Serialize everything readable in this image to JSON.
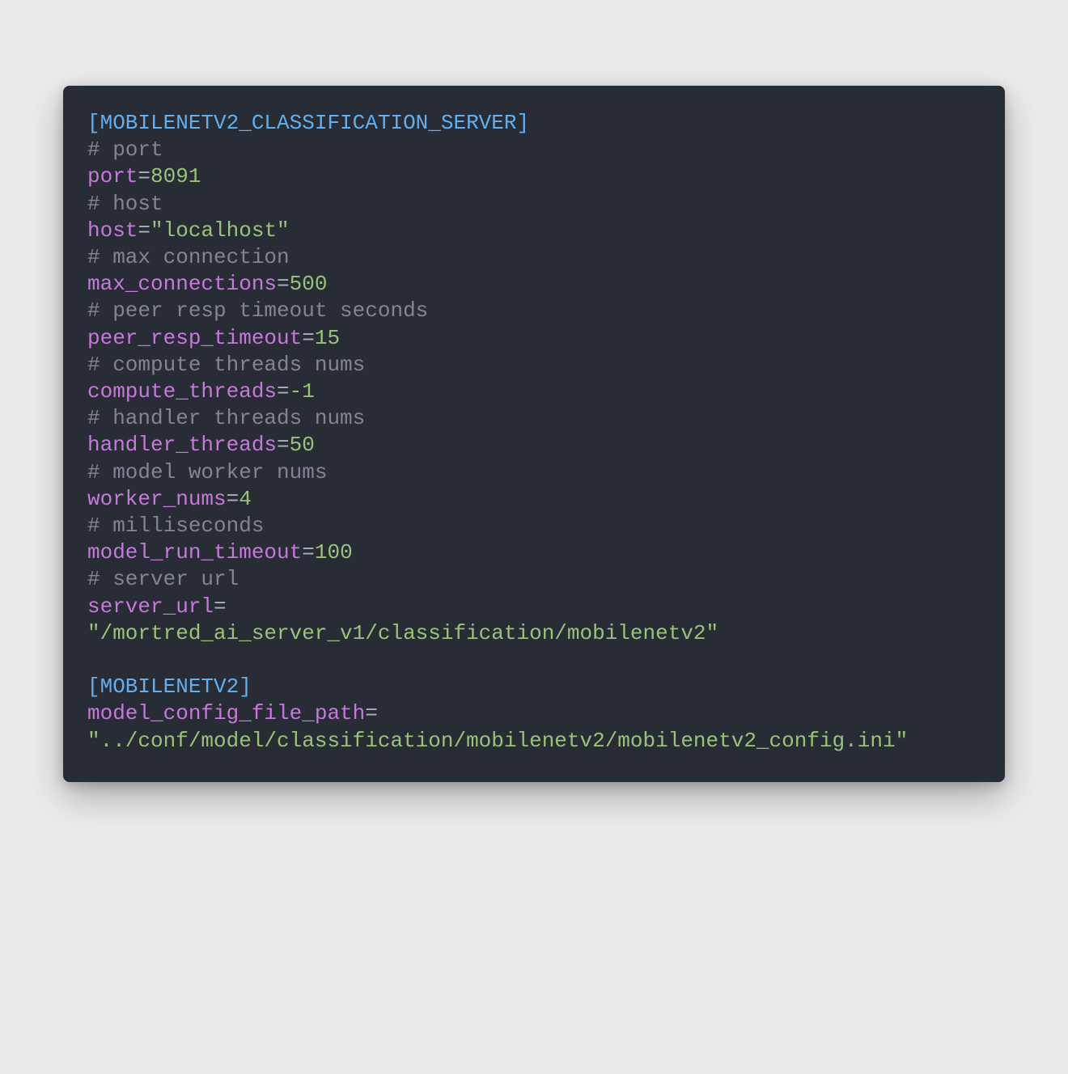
{
  "sections": [
    {
      "header": "MOBILENETV2_CLASSIFICATION_SERVER",
      "entries": [
        {
          "kind": "comment",
          "text": "# port"
        },
        {
          "kind": "kv",
          "key": "port",
          "value": "8091",
          "value_type": "number"
        },
        {
          "kind": "comment",
          "text": "# host"
        },
        {
          "kind": "kv",
          "key": "host",
          "value": "\"localhost\"",
          "value_type": "string"
        },
        {
          "kind": "comment",
          "text": "# max connection"
        },
        {
          "kind": "kv",
          "key": "max_connections",
          "value": "500",
          "value_type": "number"
        },
        {
          "kind": "comment",
          "text": "# peer resp timeout seconds"
        },
        {
          "kind": "kv",
          "key": "peer_resp_timeout",
          "value": "15",
          "value_type": "number"
        },
        {
          "kind": "comment",
          "text": "# compute threads nums"
        },
        {
          "kind": "kv",
          "key": "compute_threads",
          "value": "-1",
          "value_type": "number"
        },
        {
          "kind": "comment",
          "text": "# handler threads nums"
        },
        {
          "kind": "kv",
          "key": "handler_threads",
          "value": "50",
          "value_type": "number"
        },
        {
          "kind": "comment",
          "text": "# model worker nums"
        },
        {
          "kind": "kv",
          "key": "worker_nums",
          "value": "4",
          "value_type": "number"
        },
        {
          "kind": "comment",
          "text": "# milliseconds"
        },
        {
          "kind": "kv",
          "key": "model_run_timeout",
          "value": "100",
          "value_type": "number"
        },
        {
          "kind": "comment",
          "text": "# server url"
        },
        {
          "kind": "kv",
          "key": "server_url",
          "value": "\"/mortred_ai_server_v1/classification/mobilenetv2\"",
          "value_type": "string",
          "value_on_newline": true
        }
      ]
    },
    {
      "header": "MOBILENETV2",
      "entries": [
        {
          "kind": "kv",
          "key": "model_config_file_path",
          "value": "\"../conf/model/classification/mobilenetv2/mobilenetv2_config.ini\"",
          "value_type": "string",
          "value_on_newline": true
        }
      ]
    }
  ]
}
